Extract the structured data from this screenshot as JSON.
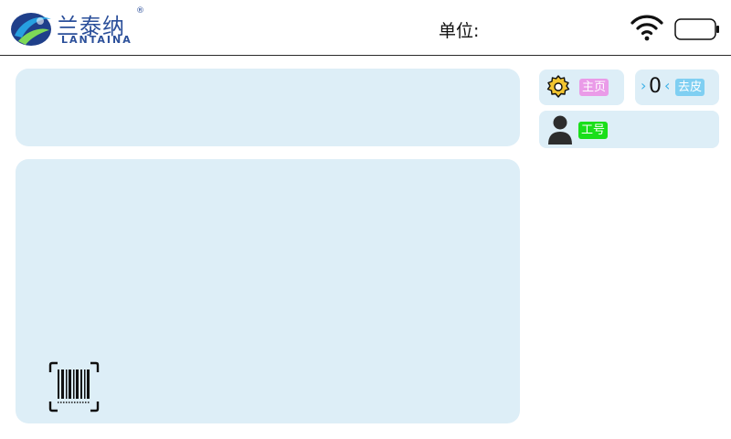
{
  "header": {
    "logo_cn": "兰泰纳",
    "logo_reg": "®",
    "logo_en": "LANTAINA",
    "unit_label": "单位:"
  },
  "icons": {
    "logo": "lantaina-logo-icon",
    "wifi": "wifi-icon",
    "battery": "battery-icon",
    "gear": "gear-icon",
    "tare": "zero-tare-icon",
    "person": "person-icon",
    "barcode": "barcode-scan-icon"
  },
  "cards": {
    "home_label": "主页",
    "tare_symbol": "0",
    "tare_left": "›",
    "tare_right": "‹",
    "tare_label": "去皮",
    "id_label": "工号"
  },
  "colors": {
    "panel_bg": "#ddeef7",
    "brand_blue": "#2b4f9a",
    "home_tag": "#ea9be8",
    "tare_tag": "#7fcff2",
    "id_tag": "#1adf1a",
    "gear_yellow": "#f2c530"
  }
}
